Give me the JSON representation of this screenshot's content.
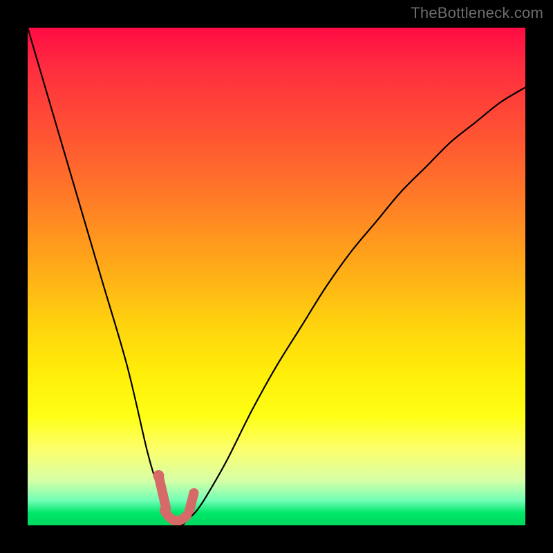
{
  "watermark": "TheBottleneck.com",
  "colors": {
    "marker": "#d66a68",
    "curve": "#000000",
    "background": "#000000"
  },
  "chart_data": {
    "type": "line",
    "title": "",
    "xlabel": "",
    "ylabel": "",
    "xlim": [
      0,
      100
    ],
    "ylim": [
      0,
      100
    ],
    "grid": false,
    "legend": false,
    "series": [
      {
        "name": "bottleneck-curve",
        "x": [
          0,
          5,
          10,
          15,
          20,
          24,
          26,
          27,
          28,
          29,
          30,
          31,
          32,
          34,
          36,
          40,
          45,
          50,
          55,
          60,
          65,
          70,
          75,
          80,
          85,
          90,
          95,
          100
        ],
        "values": [
          100,
          83,
          66,
          49,
          32,
          15,
          8,
          4,
          2,
          1,
          0,
          0,
          1,
          3,
          6,
          13,
          23,
          32,
          40,
          48,
          55,
          61,
          67,
          72,
          77,
          81,
          85,
          88
        ]
      }
    ],
    "markers": [
      {
        "name": "left-marker",
        "x_range": [
          26.5,
          28.0
        ],
        "y_range": [
          3,
          9
        ]
      },
      {
        "name": "bottom-marker",
        "x_range": [
          28.0,
          32.0
        ],
        "y_range": [
          0,
          2
        ]
      },
      {
        "name": "right-marker",
        "x_range": [
          32.0,
          33.0
        ],
        "y_range": [
          3,
          6
        ]
      }
    ]
  }
}
